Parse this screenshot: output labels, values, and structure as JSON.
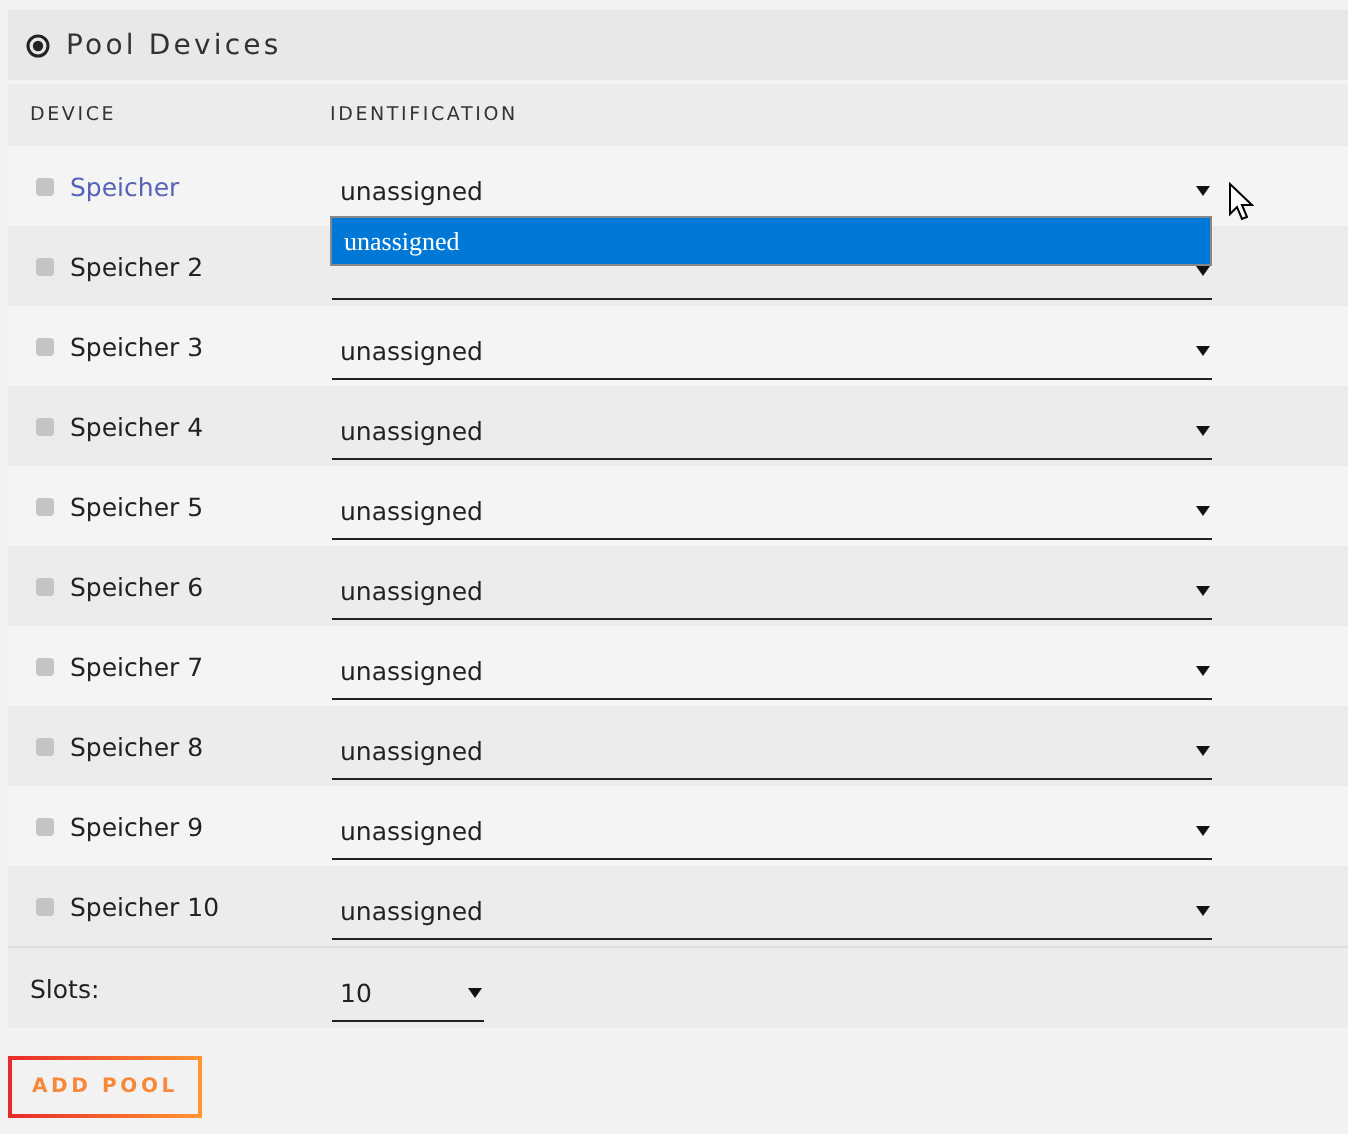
{
  "panel": {
    "title": "Pool Devices"
  },
  "columns": [
    "DEVICE",
    "IDENTIFICATION"
  ],
  "devices": [
    {
      "name": "Speicher",
      "checked": false,
      "highlighted": true,
      "identification": "unassigned",
      "open": true,
      "options": [
        {
          "label": "unassigned",
          "selected": true
        }
      ]
    },
    {
      "name": "Speicher 2",
      "checked": false,
      "highlighted": false,
      "open": false
    },
    {
      "name": "Speicher 3",
      "checked": false,
      "highlighted": false,
      "identification": "unassigned",
      "open": false
    },
    {
      "name": "Speicher 4",
      "checked": false,
      "highlighted": false,
      "identification": "unassigned",
      "open": false
    },
    {
      "name": "Speicher 5",
      "checked": false,
      "highlighted": false,
      "identification": "unassigned",
      "open": false
    },
    {
      "name": "Speicher 6",
      "checked": false,
      "highlighted": false,
      "identification": "unassigned",
      "open": false
    },
    {
      "name": "Speicher 7",
      "checked": false,
      "highlighted": false,
      "identification": "unassigned",
      "open": false
    },
    {
      "name": "Speicher 8",
      "checked": false,
      "highlighted": false,
      "identification": "unassigned",
      "open": false
    },
    {
      "name": "Speicher 9",
      "checked": false,
      "highlighted": false,
      "identification": "unassigned",
      "open": false
    },
    {
      "name": "Speicher 10",
      "checked": false,
      "highlighted": false,
      "identification": "unassigned",
      "open": false
    }
  ],
  "slots": {
    "label": "Slots:",
    "value": "10"
  },
  "add_button": "ADD POOL"
}
